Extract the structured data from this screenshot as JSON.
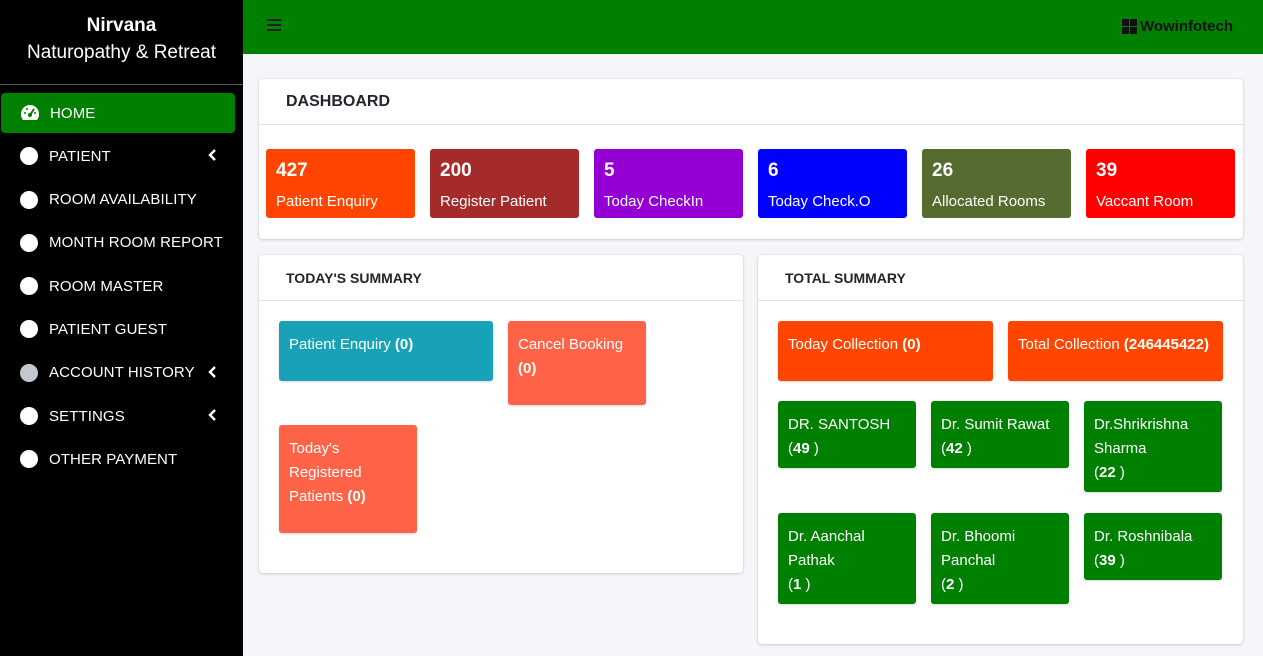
{
  "brand": {
    "line1": "Nirvana",
    "line2": "Naturopathy & Retreat"
  },
  "sidebar": {
    "items": [
      {
        "label": "HOME",
        "icon": "tachometer-icon",
        "active": true
      },
      {
        "label": "PATIENT",
        "icon": "circle-icon",
        "has_submenu": true
      },
      {
        "label": "ROOM AVAILABILITY",
        "icon": "circle-icon"
      },
      {
        "label": "MONTH ROOM REPORT",
        "icon": "circle-icon"
      },
      {
        "label": "ROOM MASTER",
        "icon": "circle-icon"
      },
      {
        "label": "PATIENT GUEST",
        "icon": "circle-icon"
      },
      {
        "label": "ACCOUNT HISTORY",
        "icon": "circle-icon",
        "has_submenu": true
      },
      {
        "label": "SETTINGS",
        "icon": "circle-icon",
        "has_submenu": true
      },
      {
        "label": "OTHER PAYMENT",
        "icon": "circle-icon"
      }
    ]
  },
  "topbar": {
    "menu_icon": "hamburger-icon",
    "company": "Wowinfotech",
    "company_icon": "windows-icon"
  },
  "dashboard": {
    "title": "DASHBOARD",
    "stats": [
      {
        "value": "427",
        "label": "Patient Enquiry",
        "color": "#ff4500"
      },
      {
        "value": "200",
        "label": "Register Patient",
        "color": "#a52a2a"
      },
      {
        "value": "5",
        "label": "Today CheckIn",
        "color": "#9400d3"
      },
      {
        "value": "6",
        "label": "Today Check.O",
        "color": "#0000ff"
      },
      {
        "value": "26",
        "label": "Allocated Rooms",
        "color": "#556b2f"
      },
      {
        "value": "39",
        "label": "Vaccant Room",
        "color": "#ff0000"
      }
    ]
  },
  "today_summary": {
    "title": "TODAY'S SUMMARY",
    "tiles": [
      {
        "label": "Patient Enquiry ",
        "value": "(0)",
        "color": "#17a2b8"
      },
      {
        "label": "Cancel Booking",
        "value": "(0)",
        "color": "#ff6347"
      },
      {
        "label": "Today's Registered Patients ",
        "value": "(0)",
        "color": "#ff6347"
      }
    ]
  },
  "total_summary": {
    "title": "TOTAL SUMMARY",
    "collections": [
      {
        "label": "Today Collection ",
        "value": "(0)",
        "color": "#ff4500"
      },
      {
        "label": "Total Collection ",
        "value": "(246445422)",
        "color": "#ff4500"
      }
    ],
    "doctors": [
      {
        "name": "DR. SANTOSH",
        "count": "49"
      },
      {
        "name": "Dr. Sumit Rawat",
        "count": "42"
      },
      {
        "name": "Dr.Shrikrishna Sharma",
        "count": "22"
      },
      {
        "name": "Dr. Aanchal Pathak",
        "count": "1"
      },
      {
        "name": "Dr. Bhoomi Panchal",
        "count": "2"
      },
      {
        "name": "Dr. Roshnibala",
        "count": "39"
      }
    ],
    "doctor_color": "#008000"
  }
}
